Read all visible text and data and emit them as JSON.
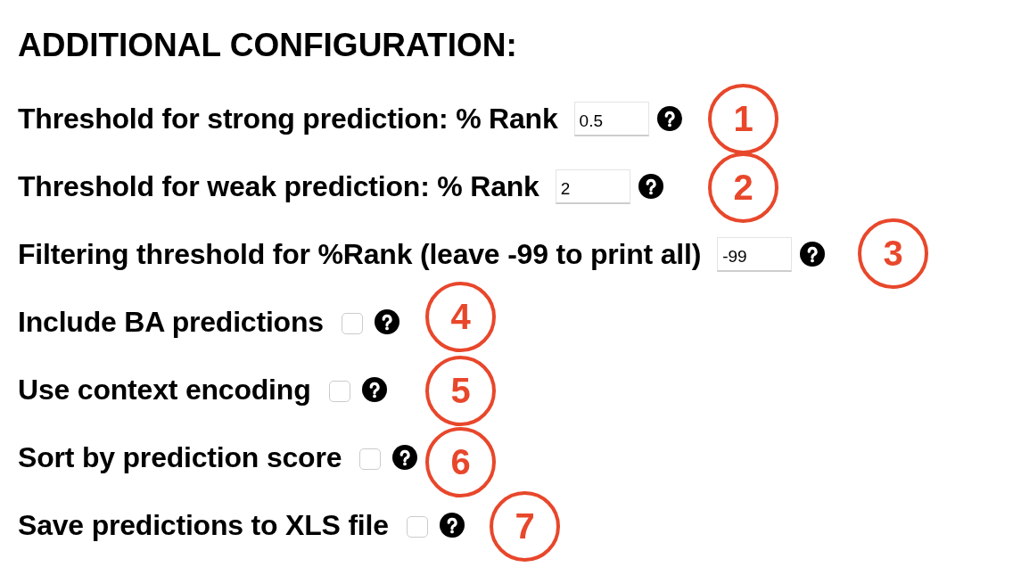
{
  "title": "ADDITIONAL CONFIGURATION:",
  "fields": [
    {
      "kind": "text",
      "label": "Threshold for strong prediction: % Rank",
      "value": "0.5",
      "annotation": "1"
    },
    {
      "kind": "text",
      "label": "Threshold for weak prediction: % Rank",
      "value": "2",
      "annotation": "2"
    },
    {
      "kind": "text",
      "label": "Filtering threshold for %Rank (leave -99 to print all)",
      "value": "-99",
      "annotation": "3"
    },
    {
      "kind": "checkbox",
      "label": "Include BA predictions",
      "checked": false,
      "annotation": "4"
    },
    {
      "kind": "checkbox",
      "label": "Use context encoding",
      "checked": false,
      "annotation": "5"
    },
    {
      "kind": "checkbox",
      "label": "Sort by prediction score",
      "checked": false,
      "annotation": "6"
    },
    {
      "kind": "checkbox",
      "label": "Save predictions to XLS file",
      "checked": false,
      "annotation": "7"
    }
  ]
}
